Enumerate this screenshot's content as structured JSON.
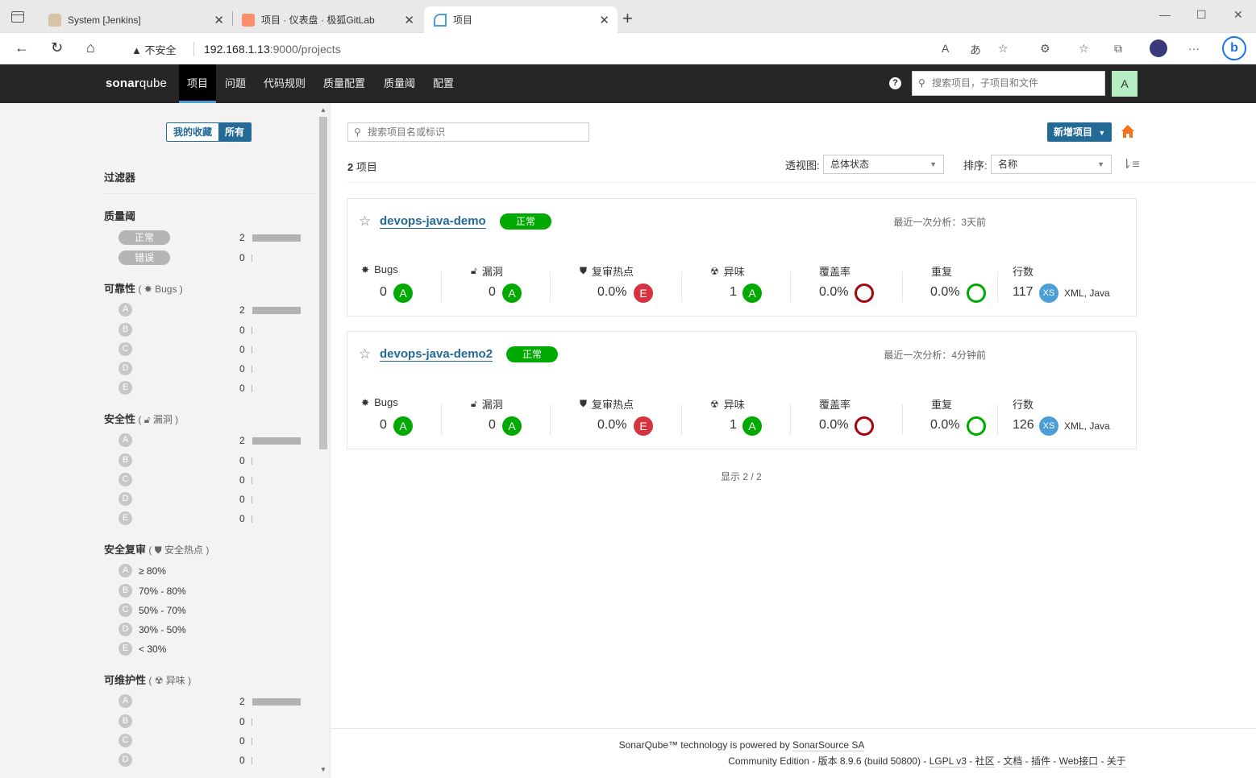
{
  "browser": {
    "tabs": [
      {
        "title": "System [Jenkins]"
      },
      {
        "title": "项目 · 仪表盘 · 极狐GitLab"
      },
      {
        "title": "项目"
      }
    ],
    "security_label": "不安全",
    "url_host": "192.168.1.13",
    "url_rest": ":9000/projects"
  },
  "nav": {
    "logo_a": "sonar",
    "logo_b": "qube",
    "items": [
      "项目",
      "问题",
      "代码规则",
      "质量配置",
      "质量阈",
      "配置"
    ],
    "search_placeholder": "搜索项目，子项目和文件",
    "user_initial": "A"
  },
  "sidebar": {
    "toggle_fav": "我的收藏",
    "toggle_all": "所有",
    "filter_title": "过滤器",
    "quality_gate": {
      "title": "质量阈",
      "rows": [
        {
          "label": "正常",
          "count": "2",
          "fraction": 1.0
        },
        {
          "label": "错误",
          "count": "0",
          "fraction": 0
        }
      ]
    },
    "reliability": {
      "title": "可靠性",
      "sub": "Bugs",
      "rows": [
        {
          "g": "A",
          "c": "2"
        },
        {
          "g": "B",
          "c": "0"
        },
        {
          "g": "C",
          "c": "0"
        },
        {
          "g": "D",
          "c": "0"
        },
        {
          "g": "E",
          "c": "0"
        }
      ]
    },
    "security": {
      "title": "安全性",
      "sub": "漏洞",
      "rows": [
        {
          "g": "A",
          "c": "2"
        },
        {
          "g": "B",
          "c": "0"
        },
        {
          "g": "C",
          "c": "0"
        },
        {
          "g": "D",
          "c": "0"
        },
        {
          "g": "E",
          "c": "0"
        }
      ]
    },
    "hotspots": {
      "title": "安全复审",
      "sub": "安全热点",
      "rows": [
        {
          "g": "A",
          "r": "≥ 80%"
        },
        {
          "g": "B",
          "r": "70% - 80%"
        },
        {
          "g": "C",
          "r": "50% - 70%"
        },
        {
          "g": "D",
          "r": "30% - 50%"
        },
        {
          "g": "E",
          "r": "< 30%"
        }
      ]
    },
    "maintainability": {
      "title": "可维护性",
      "sub": "异味",
      "rows": [
        {
          "g": "A",
          "c": "2"
        },
        {
          "g": "B",
          "c": "0"
        },
        {
          "g": "C",
          "c": "0"
        },
        {
          "g": "D",
          "c": "0"
        }
      ]
    }
  },
  "main": {
    "search_placeholder": "搜索项目名或标识",
    "new_project": "新增项目",
    "count_num": "2",
    "count_unit": "项目",
    "perspective_label": "透视图:",
    "perspective_value": "总体状态",
    "sort_label": "排序:",
    "sort_value": "名称",
    "metric_labels": {
      "bugs": "Bugs",
      "vulns": "漏洞",
      "hotspots": "复审热点",
      "smells": "异味",
      "coverage": "覆盖率",
      "dup": "重复",
      "lines": "行数"
    },
    "projects": [
      {
        "name": "devops-java-demo",
        "status": "正常",
        "last": "最近一次分析：3天前",
        "bugs": "0",
        "bugs_r": "A",
        "vulns": "0",
        "vulns_r": "A",
        "hot": "0.0%",
        "hot_r": "E",
        "smells": "1",
        "smells_r": "A",
        "cov": "0.0%",
        "dup": "0.0%",
        "lines": "117",
        "size": "XS",
        "langs": "XML, Java"
      },
      {
        "name": "devops-java-demo2",
        "status": "正常",
        "last": "最近一次分析：4分钟前",
        "bugs": "0",
        "bugs_r": "A",
        "vulns": "0",
        "vulns_r": "A",
        "hot": "0.0%",
        "hot_r": "E",
        "smells": "1",
        "smells_r": "A",
        "cov": "0.0%",
        "dup": "0.0%",
        "lines": "126",
        "size": "XS",
        "langs": "XML, Java"
      }
    ],
    "showing": "显示 2 / 2"
  },
  "footer": {
    "line1_a": "SonarQube™ technology is powered by ",
    "line1_b": "SonarSource SA",
    "line2_a": "Community Edition - 版本 8.9.6 (build 50800) - ",
    "lgpl": "LGPL v3",
    "community": "社区",
    "docs": "文档",
    "plugins": "插件",
    "webapi": "Web接口",
    "about": "关于"
  },
  "colors": {
    "green": "#00aa00",
    "red": "#d4333f",
    "blue": "#236a97",
    "nav": "#262626",
    "coverage_ring": "#a4030f"
  }
}
